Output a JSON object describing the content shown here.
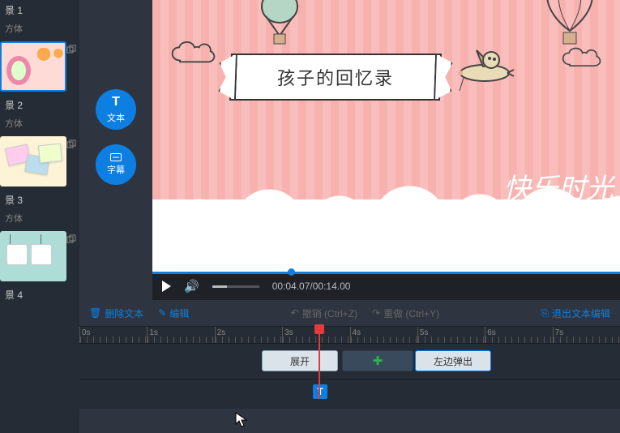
{
  "sidebar": {
    "items": [
      {
        "label": "景 1",
        "sub": "方体"
      },
      {
        "label": "景 2",
        "sub": "方体"
      },
      {
        "label": "景 3",
        "sub": "方体"
      },
      {
        "label": "景 4"
      }
    ]
  },
  "tools": {
    "text": "文本",
    "subtitle": "字幕"
  },
  "canvas": {
    "banner": "孩子的回忆录",
    "happy": "快乐时光"
  },
  "player": {
    "time": "00:04.07/00:14.00"
  },
  "tl_toolbar": {
    "delete": "删除文本",
    "edit": "编辑",
    "undo": "撤销 (Ctrl+Z)",
    "redo": "重做 (Ctrl+Y)",
    "exit": "退出文本编辑"
  },
  "ruler": [
    "0s",
    "1s",
    "2s",
    "3s",
    "4s",
    "5s",
    "6s",
    "7s"
  ],
  "clips": {
    "expand": "展开",
    "left_out": "左边弹出",
    "t_badge": "T"
  }
}
